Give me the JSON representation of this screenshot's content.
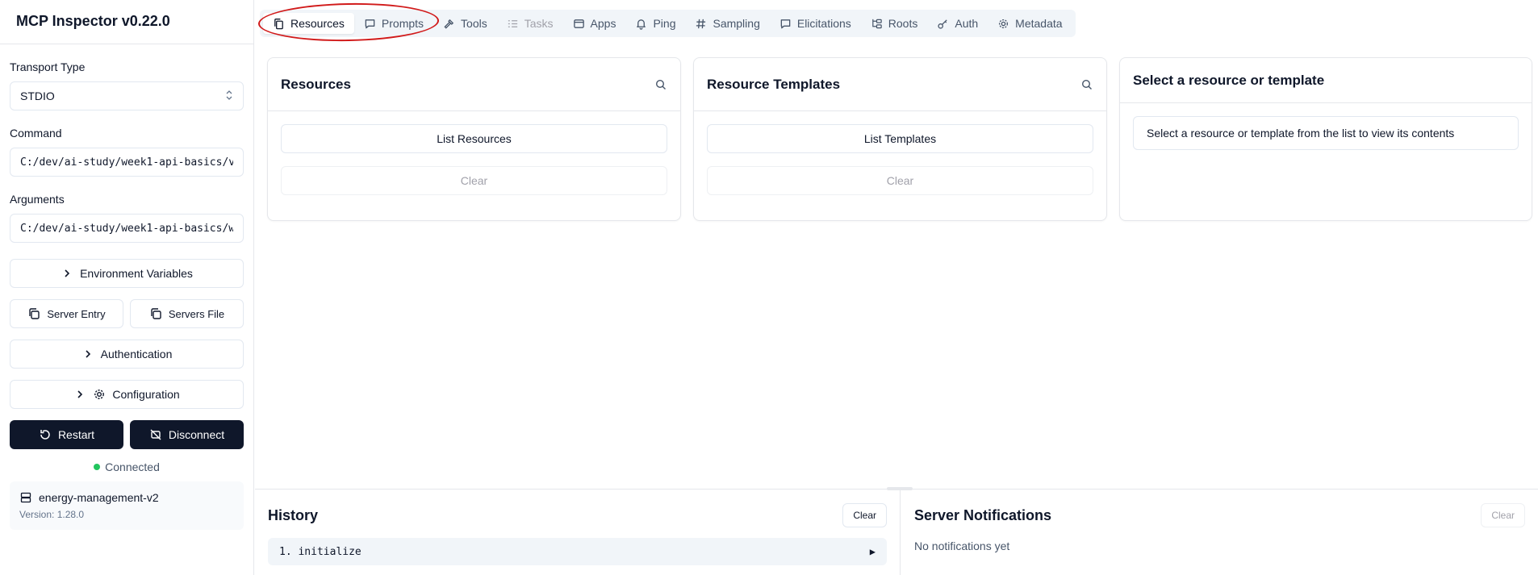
{
  "app": {
    "title": "MCP Inspector v0.22.0"
  },
  "sidebar": {
    "transport_label": "Transport Type",
    "transport_value": "STDIO",
    "command_label": "Command",
    "command_value": "C:/dev/ai-study/week1-api-basics/v",
    "arguments_label": "Arguments",
    "arguments_value": "C:/dev/ai-study/week1-api-basics/w",
    "env_label": "Environment Variables",
    "server_entry_label": "Server Entry",
    "servers_file_label": "Servers File",
    "auth_label": "Authentication",
    "config_label": "Configuration",
    "restart_label": "Restart",
    "disconnect_label": "Disconnect",
    "status_text": "Connected",
    "server_name": "energy-management-v2",
    "server_version": "Version: 1.28.0"
  },
  "tabs": [
    {
      "label": "Resources",
      "active": true
    },
    {
      "label": "Prompts"
    },
    {
      "label": "Tools"
    },
    {
      "label": "Tasks",
      "disabled": true
    },
    {
      "label": "Apps"
    },
    {
      "label": "Ping"
    },
    {
      "label": "Sampling"
    },
    {
      "label": "Elicitations"
    },
    {
      "label": "Roots"
    },
    {
      "label": "Auth"
    },
    {
      "label": "Metadata"
    }
  ],
  "resources_panel": {
    "title": "Resources",
    "list_label": "List Resources",
    "clear_label": "Clear"
  },
  "templates_panel": {
    "title": "Resource Templates",
    "list_label": "List Templates",
    "clear_label": "Clear"
  },
  "detail_panel": {
    "title": "Select a resource or template",
    "message": "Select a resource or template from the list to view its contents"
  },
  "history": {
    "title": "History",
    "clear_label": "Clear",
    "items": [
      "1. initialize"
    ]
  },
  "notifications": {
    "title": "Server Notifications",
    "clear_label": "Clear",
    "empty_text": "No notifications yet"
  },
  "colors": {
    "accent_dark": "#0f172a",
    "connected": "#22c55e",
    "annotation": "#d11a1a"
  }
}
